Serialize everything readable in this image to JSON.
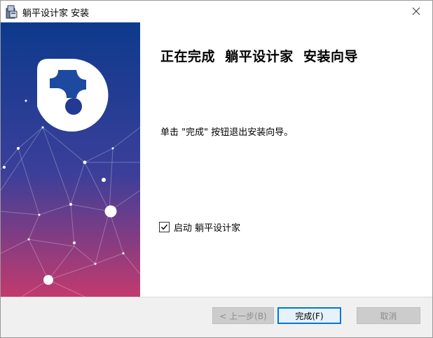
{
  "window": {
    "title": "躺平设计家 安装",
    "icon": "installer-icon",
    "close_icon": "close-icon"
  },
  "banner": {
    "gradient_top": "#0d3a8c",
    "gradient_mid": "#3b3f9a",
    "gradient_bottom": "#c23a6e",
    "logo": "puzzle-logo-icon"
  },
  "content": {
    "heading": "正在完成  躺平设计家  安装向导",
    "instruction": "单击 \"完成\" 按钮退出安装向导。",
    "launch_checkbox": {
      "checked": true,
      "label": "启动 躺平设计家"
    }
  },
  "footer": {
    "back_label": "< 上一步(B)",
    "finish_label": "完成(F)",
    "cancel_label": "取消"
  }
}
